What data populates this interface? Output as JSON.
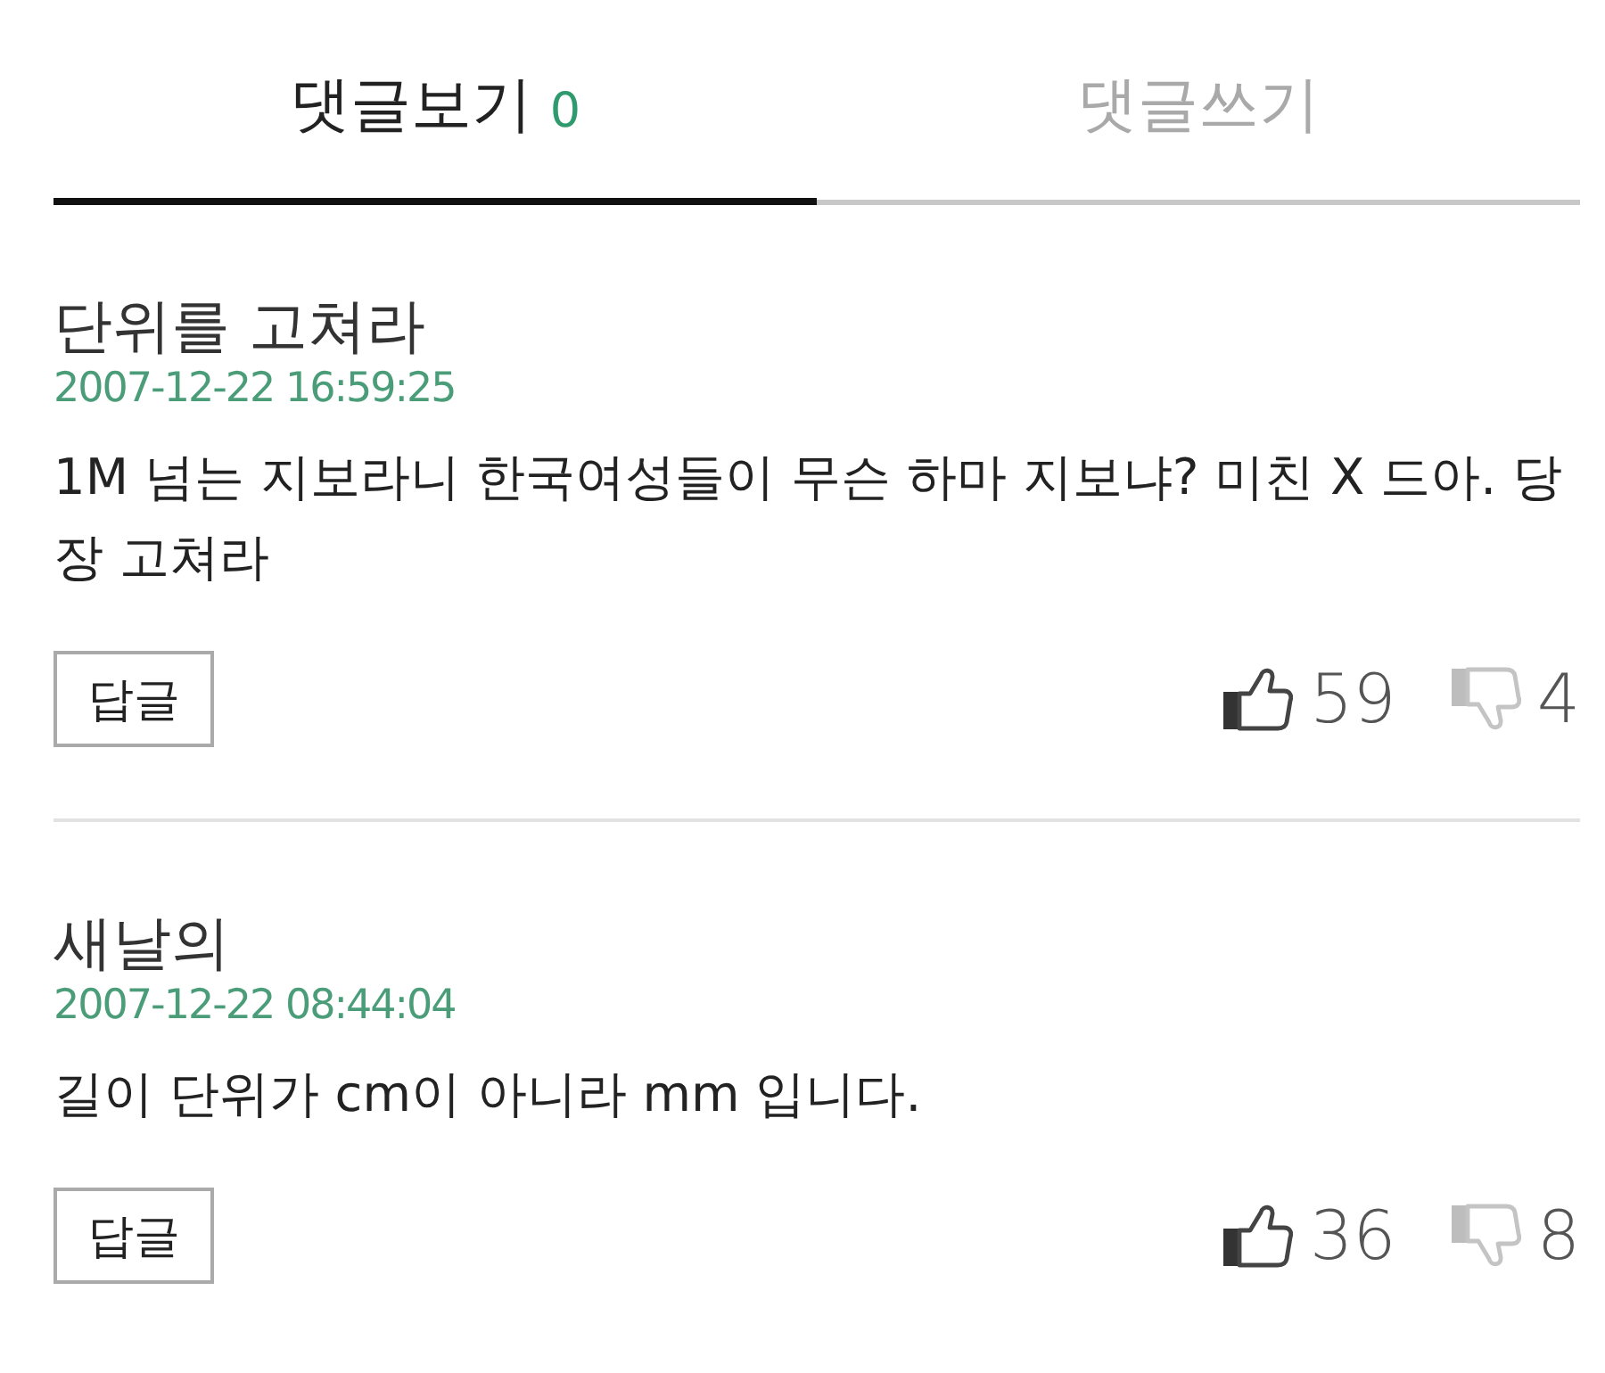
{
  "tabs": [
    {
      "label": "댓글보기",
      "count": "0",
      "selected": true
    },
    {
      "label": "댓글쓰기",
      "selected": false
    }
  ],
  "comments": [
    {
      "author": "단위를 고쳐라",
      "date": "2007-12-22 16:59:25",
      "body": "1M 넘는 지보라니 한국여성들이 무슨 하마 지보냐? 미친 X 드아. 당장 고쳐라",
      "reply_button": "답글",
      "likes": "59",
      "dislikes": "4"
    },
    {
      "author": "새날의",
      "date": "2007-12-22 08:44:04",
      "body": "길이 단위가 cm이 아니라 mm 입니다.",
      "reply_button": "답글",
      "likes": "36",
      "dislikes": "8"
    }
  ]
}
